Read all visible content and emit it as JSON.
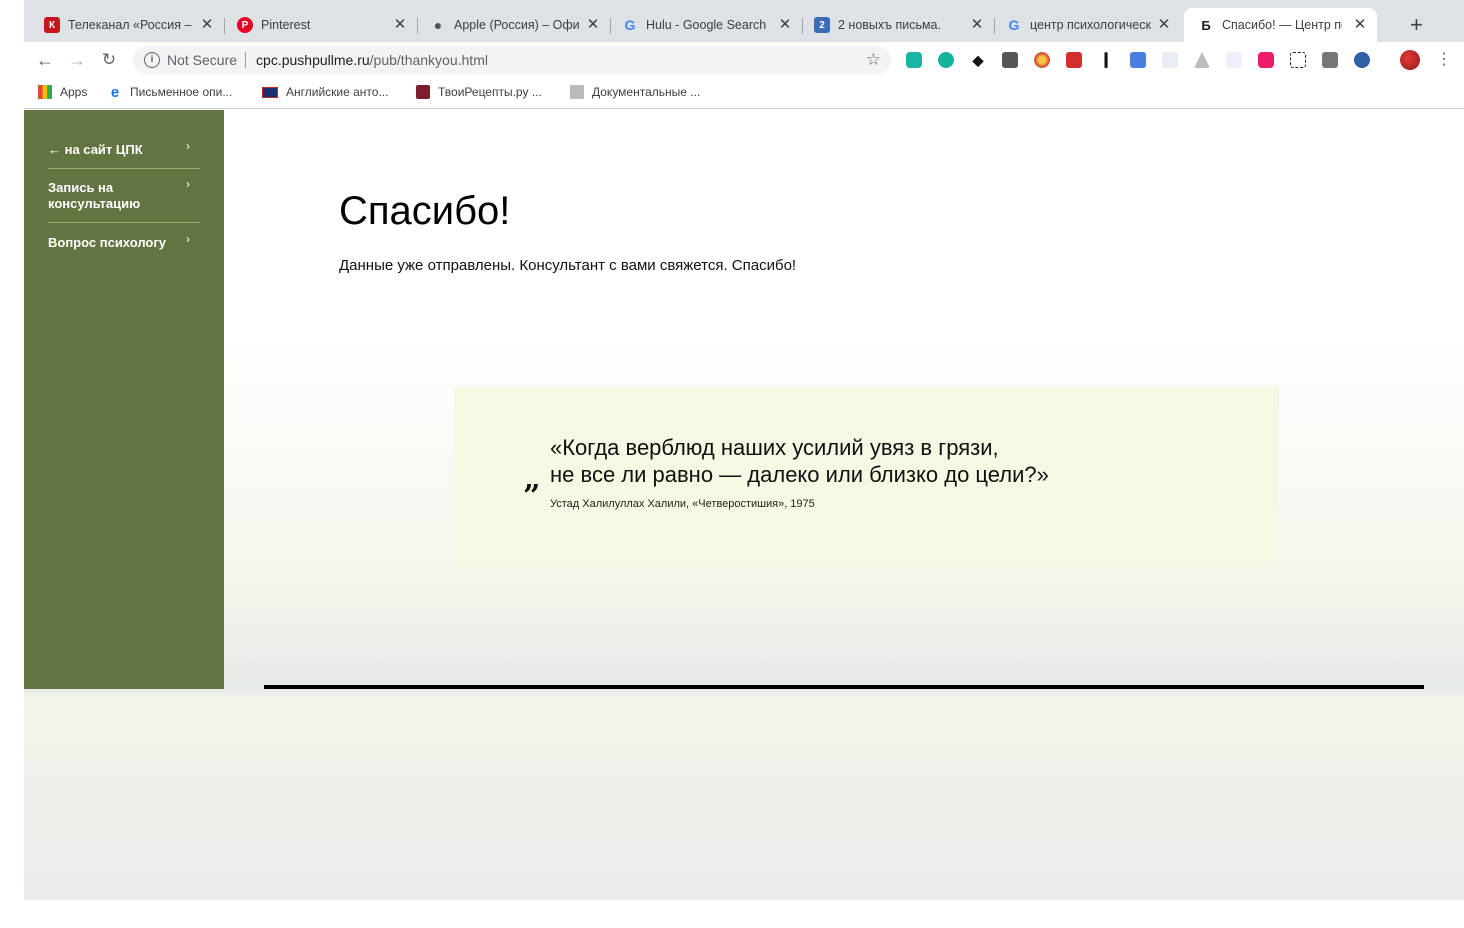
{
  "browser": {
    "tabs": [
      {
        "title": "Телеканал «Россия –",
        "favicon_letter": "К",
        "favicon_color": "#c4161c"
      },
      {
        "title": "Pinterest",
        "favicon_letter": "P",
        "favicon_color": "#e60023"
      },
      {
        "title": "Apple (Россия) – Офи",
        "favicon_letter": "",
        "favicon_color": "#555555"
      },
      {
        "title": "Hulu - Google Search",
        "favicon_letter": "G",
        "favicon_color": "#4285f4"
      },
      {
        "title": "2 новыхъ письма.",
        "favicon_letter": "2",
        "favicon_color": "#3b6cb7"
      },
      {
        "title": "центр психологическ",
        "favicon_letter": "G",
        "favicon_color": "#4285f4"
      },
      {
        "title": "Спасибо! — Центр пс",
        "favicon_letter": "Б",
        "favicon_color": "#222222",
        "active": true
      }
    ],
    "address": {
      "security_label": "Not Secure",
      "host": "cpc.pushpullme.ru",
      "path": "/pub/thankyou.html"
    },
    "bookmarks": [
      {
        "label": "Apps",
        "icon": "apps-grid-icon"
      },
      {
        "label": "Письменное опи...",
        "icon": "e-icon"
      },
      {
        "label": "Английские анто...",
        "icon": "uk-flag-icon"
      },
      {
        "label": "ТвоиРецепты.ру ...",
        "icon": "recipe-icon"
      },
      {
        "label": "Документальные ...",
        "icon": "document-icon"
      }
    ]
  },
  "sidebar": {
    "items": [
      {
        "label": "← на сайт ЦПК"
      },
      {
        "label": "Запись на консультацию"
      },
      {
        "label": "Вопрос психологу"
      }
    ]
  },
  "main": {
    "heading": "Спасибо!",
    "message": "Данные уже отправлены. Консультант с вами свяжется. Спасибо!"
  },
  "quote": {
    "line1": "«Когда верблюд наших усилий увяз в грязи,",
    "line2": "не все ли равно — далеко или близко до цели?»",
    "author": "Устад Халилуллах Халили, «Четверостишия», 1975"
  },
  "colors": {
    "sidebar_bg": "#627540",
    "quote_bg": "#f5f8e2"
  }
}
